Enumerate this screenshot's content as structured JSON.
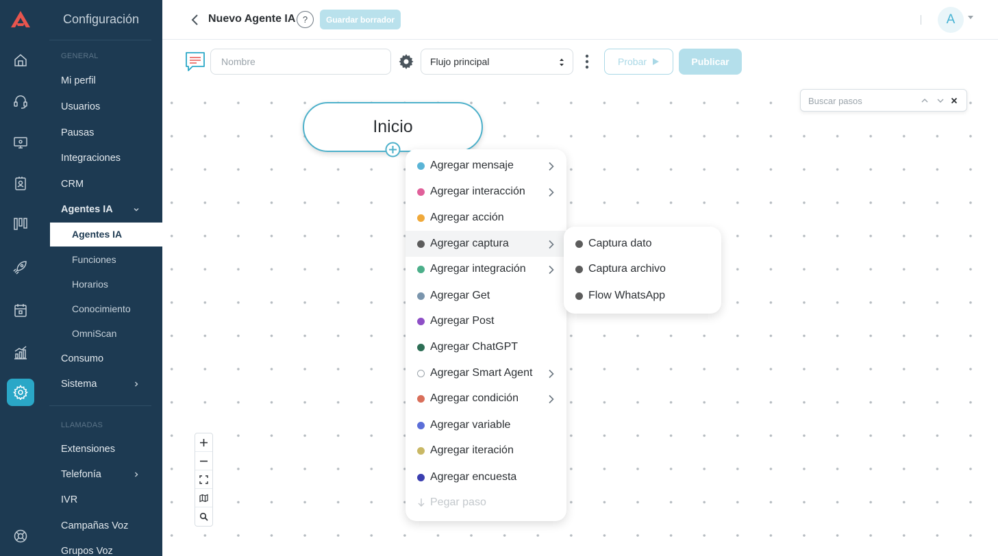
{
  "header": {
    "title": "Nuevo Agente IA",
    "help_label": "?",
    "save_draft_label": "Guardar borrador",
    "avatar_initial": "A"
  },
  "settings_nav": {
    "title": "Configuración",
    "sections": {
      "general": "GENERAL",
      "calls": "LLAMADAS"
    },
    "items": {
      "my_profile": "Mi perfil",
      "users": "Usuarios",
      "breaks": "Pausas",
      "integrations": "Integraciones",
      "crm": "CRM",
      "ai_agents": "Agentes IA",
      "ai_agents_sub": "Agentes IA",
      "functions": "Funciones",
      "schedules": "Horarios",
      "knowledge": "Conocimiento",
      "omniscan": "OmniScan",
      "consumption": "Consumo",
      "system": "Sistema",
      "extensions": "Extensiones",
      "telephony": "Telefonía",
      "ivr": "IVR",
      "voice_campaigns": "Campañas Voz",
      "voice_groups": "Grupos Voz"
    }
  },
  "rail_icons": [
    "logo-icon",
    "home-icon",
    "headset-icon",
    "monitor-icon",
    "contacts-icon",
    "kanban-icon",
    "rocket-icon",
    "calendar-icon",
    "analytics-icon",
    "settings-icon",
    "help-support-icon"
  ],
  "toolbar": {
    "name_placeholder": "Nombre",
    "flow_selected": "Flujo principal",
    "test_label": "Probar",
    "publish_label": "Publicar"
  },
  "canvas": {
    "search_placeholder": "Buscar pasos",
    "start_node_label": "Inicio"
  },
  "add_menu": [
    {
      "label": "Agregar mensaje",
      "color": "#5ab4d6",
      "submenu": true
    },
    {
      "label": "Agregar interacción",
      "color": "#e0609a",
      "submenu": true
    },
    {
      "label": "Agregar acción",
      "color": "#f0a93a",
      "submenu": false
    },
    {
      "label": "Agregar captura",
      "color": "#5c5c5c",
      "submenu": true
    },
    {
      "label": "Agregar integración",
      "color": "#4caf8a",
      "submenu": true
    },
    {
      "label": "Agregar Get",
      "color": "#7a95ad",
      "submenu": false
    },
    {
      "label": "Agregar Post",
      "color": "#8e4fc6",
      "submenu": false
    },
    {
      "label": "Agregar ChatGPT",
      "color": "#2d6e55",
      "submenu": false
    },
    {
      "label": "Agregar Smart Agent",
      "color": "#ffffff",
      "submenu": true
    },
    {
      "label": "Agregar condición",
      "color": "#d96f5a",
      "submenu": true
    },
    {
      "label": "Agregar variable",
      "color": "#5b6ed8",
      "submenu": false
    },
    {
      "label": "Agregar iteración",
      "color": "#c9b865",
      "submenu": false
    },
    {
      "label": "Agregar encuesta",
      "color": "#3b3fb0",
      "submenu": false
    }
  ],
  "paste_step_label": "Pegar paso",
  "capture_submenu": [
    {
      "label": "Captura dato",
      "color": "#5c5c5c"
    },
    {
      "label": "Captura archivo",
      "color": "#5c5c5c"
    },
    {
      "label": "Flow WhatsApp",
      "color": "#5c5c5c"
    }
  ],
  "colors": {
    "sidebar_bg": "#1d3a52",
    "accent": "#2aa7c7",
    "node_border": "#4cb0ca"
  }
}
